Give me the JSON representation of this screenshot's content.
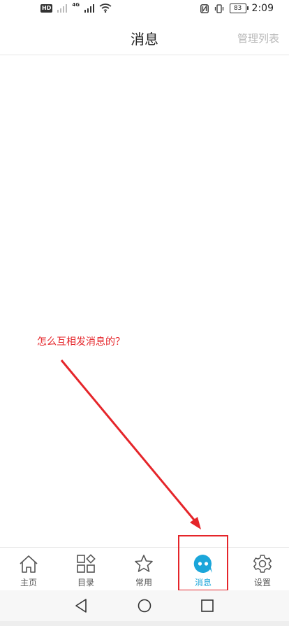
{
  "status_bar": {
    "hd": "HD",
    "network": "4G",
    "battery": "83",
    "time": "2:09"
  },
  "header": {
    "title": "消息",
    "action": "管理列表"
  },
  "annotation": {
    "text": "怎么互相发消息的？",
    "color": "#e5252a"
  },
  "tabs": [
    {
      "label": "主页",
      "icon": "home-icon"
    },
    {
      "label": "目录",
      "icon": "catalog-icon"
    },
    {
      "label": "常用",
      "icon": "star-icon"
    },
    {
      "label": "消息",
      "icon": "message-icon",
      "active": true
    },
    {
      "label": "设置",
      "icon": "gear-icon"
    }
  ],
  "colors": {
    "accent": "#1ba6da",
    "annotation": "#e5252a",
    "muted_action": "#b8b8b8"
  }
}
